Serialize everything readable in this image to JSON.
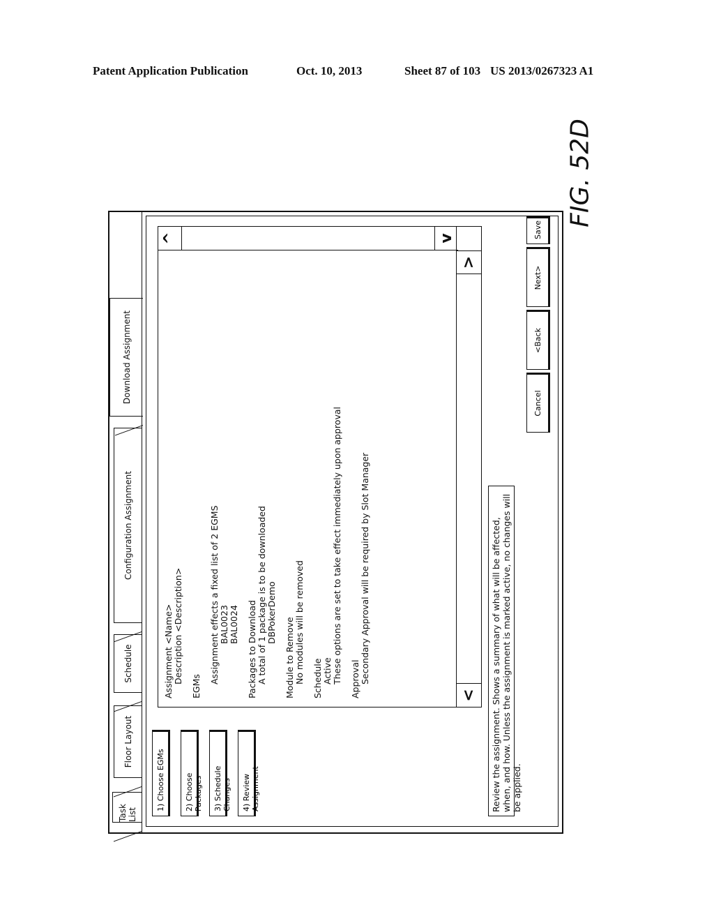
{
  "header": {
    "publication": "Patent Application Publication",
    "date": "Oct. 10, 2013",
    "sheet": "Sheet 87 of 103",
    "number": "US 2013/0267323 A1"
  },
  "figure_label": "FIG. 52D",
  "tabs": [
    {
      "label": "Task List",
      "active": false
    },
    {
      "label": "Floor Layout",
      "active": false
    },
    {
      "label": "Schedule",
      "active": false
    },
    {
      "label": "Configuration Assignment",
      "active": false
    },
    {
      "label": "Download Assignment",
      "active": true
    }
  ],
  "steps": [
    {
      "label": "1) Choose EGMs"
    },
    {
      "label": "2) Choose Packages"
    },
    {
      "label": "3) Schedule Changes"
    },
    {
      "label": "4) Review Assignment"
    }
  ],
  "summary": {
    "assignment_heading": "Assignment <Name>",
    "description": "Description <Description>",
    "egms_heading": "EGMs",
    "egms_text": "Assignment effects a fixed list of 2 EGMS",
    "egms_list": [
      "BAL0023",
      "BAL0024"
    ],
    "packages_heading": "Packages to Download",
    "packages_text": "A total of 1 package is to be downloaded",
    "packages_list": [
      "DBPokerDemo"
    ],
    "module_heading": "Module to Remove",
    "module_text": "No modules will be removed",
    "schedule_heading": "Schedule",
    "schedule_status": "Active",
    "schedule_text": "These options are set to take effect immediately upon approval",
    "approval_heading": "Approval",
    "approval_text": "Secondary Approval will be required by Slot Manager"
  },
  "scroll_icons": {
    "up": "^",
    "down": "v",
    "left": "<",
    "right": ">"
  },
  "step_description": "Review the assignment. Shows a summary of what will be affected, when, and how. Unless the assignment is marked active, no changes will be applied.",
  "actions": {
    "cancel": "Cancel",
    "back": "<Back",
    "next": "Next>",
    "save": "Save"
  }
}
